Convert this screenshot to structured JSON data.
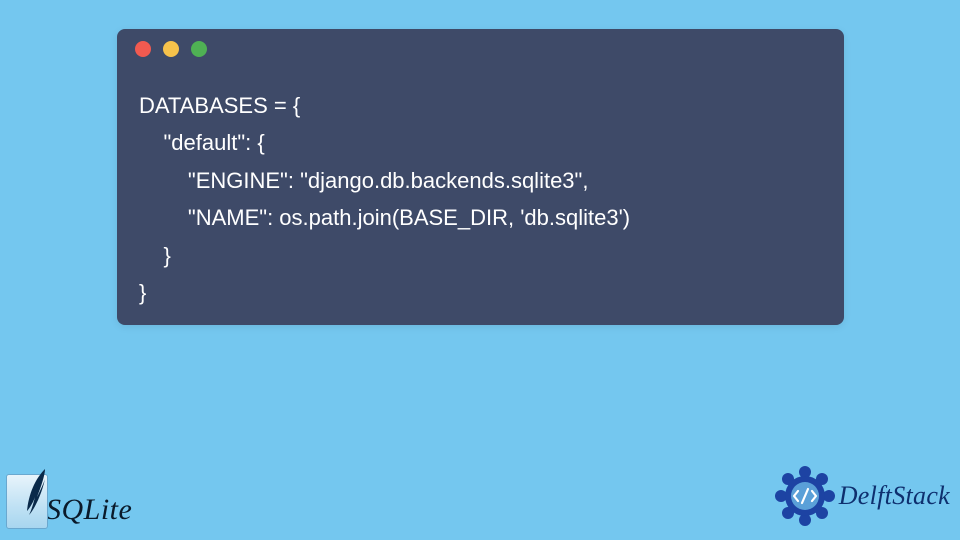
{
  "code": {
    "line1": "DATABASES = {",
    "line2": "    \"default\": {",
    "line3": "        \"ENGINE\": \"django.db.backends.sqlite3\",",
    "line4": "        \"NAME\": os.path.join(BASE_DIR, 'db.sqlite3')",
    "line5": "    }",
    "line6": "}"
  },
  "logos": {
    "sqlite": "SQLite",
    "delftstack": "DelftStack"
  },
  "colors": {
    "background": "#74c7ef",
    "window": "#3e4a68",
    "badge": "#1d43a3"
  }
}
